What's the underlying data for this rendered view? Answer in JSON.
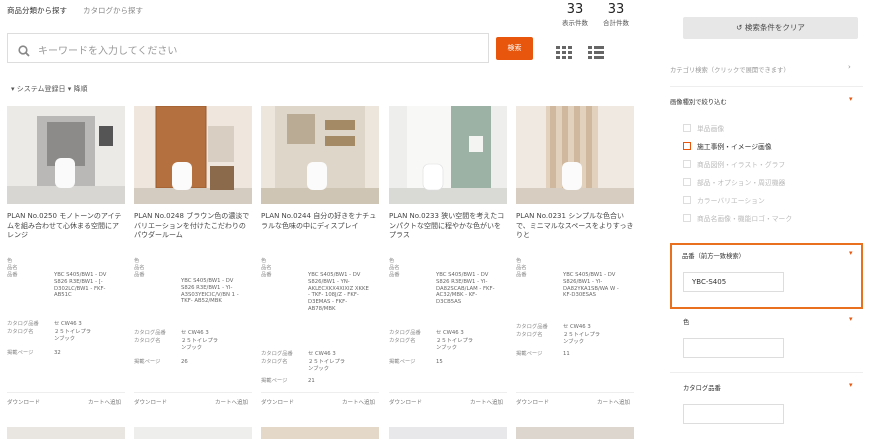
{
  "tabs": {
    "category": "商品分類から探す",
    "catalog": "カタログから探す"
  },
  "counts": {
    "display_value": "33",
    "display_label": "表示件数",
    "total_value": "33",
    "total_label": "合計件数"
  },
  "search": {
    "placeholder": "キーワードを入力してください",
    "button": "検索"
  },
  "sort": {
    "label": "▾ システム登録日  ▾ 降順"
  },
  "cards": [
    {
      "title": "PLAN No.0250 モノトーンのアイテムを組み合わせて心休まる空間にアレンジ",
      "meta": [
        "色",
        "品名",
        "品番"
      ],
      "code": "YBC S405/BW1 - DV S826 R3E/BW1 - [- D302LC/BW1 - FKF-AB51C",
      "rows": [
        {
          "k": "カタログ品番",
          "v": "セ CW46 3"
        },
        {
          "k": "カタログ名",
          "v": "２５トイレプランブック"
        },
        {
          "k": "掲載ページ",
          "v": "32"
        }
      ],
      "download": "ダウンロード",
      "cart": "カートへ追加"
    },
    {
      "title": "PLAN No.0248 ブラウン色の濃淡でバリエーションを付けたこだわりのパウダールーム",
      "meta": [
        "色",
        "品名",
        "品番"
      ],
      "code": "YBC S405/BW1 - DV S826 R3E/BW1 - YI- A3S03YEICIC/V/BN 1 - TKF- AB52/MBK",
      "rows": [
        {
          "k": "カタログ品番",
          "v": "セ CW46 3"
        },
        {
          "k": "カタログ名",
          "v": "２５トイレプランブック"
        },
        {
          "k": "掲載ページ",
          "v": "26"
        }
      ],
      "download": "ダウンロード",
      "cart": "カートへ追加"
    },
    {
      "title": "PLAN No.0244 自分の好きをナチュラルな色味の中にディスプレイ",
      "meta": [
        "色",
        "品名",
        "品番"
      ],
      "code": "YBC S405/BW1 - DV S826/BW1 - YN- AKLECXKX4XIXIZ XKKE - TKF- 108J/Z - FKF- D3EMAS - FKF- AB78/MBK",
      "rows": [
        {
          "k": "カタログ品番",
          "v": "セ CW46 3"
        },
        {
          "k": "カタログ名",
          "v": "２５トイレプランブック"
        },
        {
          "k": "掲載ページ",
          "v": "21"
        }
      ],
      "download": "ダウンロード",
      "cart": "カートへ追加"
    },
    {
      "title": "PLAN No.0233 狭い空間を考えたコンパクトな空間に程やかな色がいをプラス",
      "meta": [
        "色",
        "品名",
        "品番"
      ],
      "code": "YBC S405/BW1 - DV S826 R3E/BW1 - YI- DA82SCAB/LAM - FKF-AC32/MBK - KF-D3CB5AS",
      "rows": [
        {
          "k": "カタログ品番",
          "v": "セ CW46 3"
        },
        {
          "k": "カタログ名",
          "v": "２５トイレプランブック"
        },
        {
          "k": "掲載ページ",
          "v": "15"
        }
      ],
      "download": "ダウンロード",
      "cart": "カートへ追加"
    },
    {
      "title": "PLAN No.0231 シンプルな色合いで、ミニマルなスペースをよりすっきりと",
      "meta": [
        "色",
        "品名",
        "品番"
      ],
      "code": "YBC S405/BW1 - DV S826/BW1 - YI- DA82YKA1SB/WA W - KF-D30ESAS",
      "rows": [
        {
          "k": "カタログ品番",
          "v": "セ CW46 3"
        },
        {
          "k": "カタログ名",
          "v": "２５トイレプランブック"
        },
        {
          "k": "掲載ページ",
          "v": "11"
        }
      ],
      "download": "ダウンロード",
      "cart": "カートへ追加"
    }
  ],
  "sidebar": {
    "clear": "↺ 検索条件をクリア",
    "category_search": "カテゴリ検索（クリックで展開できます）",
    "image_filter": "画像種別で絞り込む",
    "options": [
      {
        "label": "単品画像",
        "checked": false
      },
      {
        "label": "施工事例・イメージ画像",
        "checked": true
      },
      {
        "label": "商品図例・イラスト・グラフ",
        "checked": false
      },
      {
        "label": "部品・オプション・周辺機器",
        "checked": false
      },
      {
        "label": "カラーバリエーション",
        "checked": false
      },
      {
        "label": "商品名画像・機能ロゴ・マーク",
        "checked": false
      }
    ],
    "part_number_label": "品番（前方一致検索）",
    "part_number_value": "YBC-S405",
    "color_label": "色",
    "catalog_number_label": "カタログ品番"
  },
  "colors": {
    "accent": "#e8560e",
    "highlight": "#e8701e"
  }
}
